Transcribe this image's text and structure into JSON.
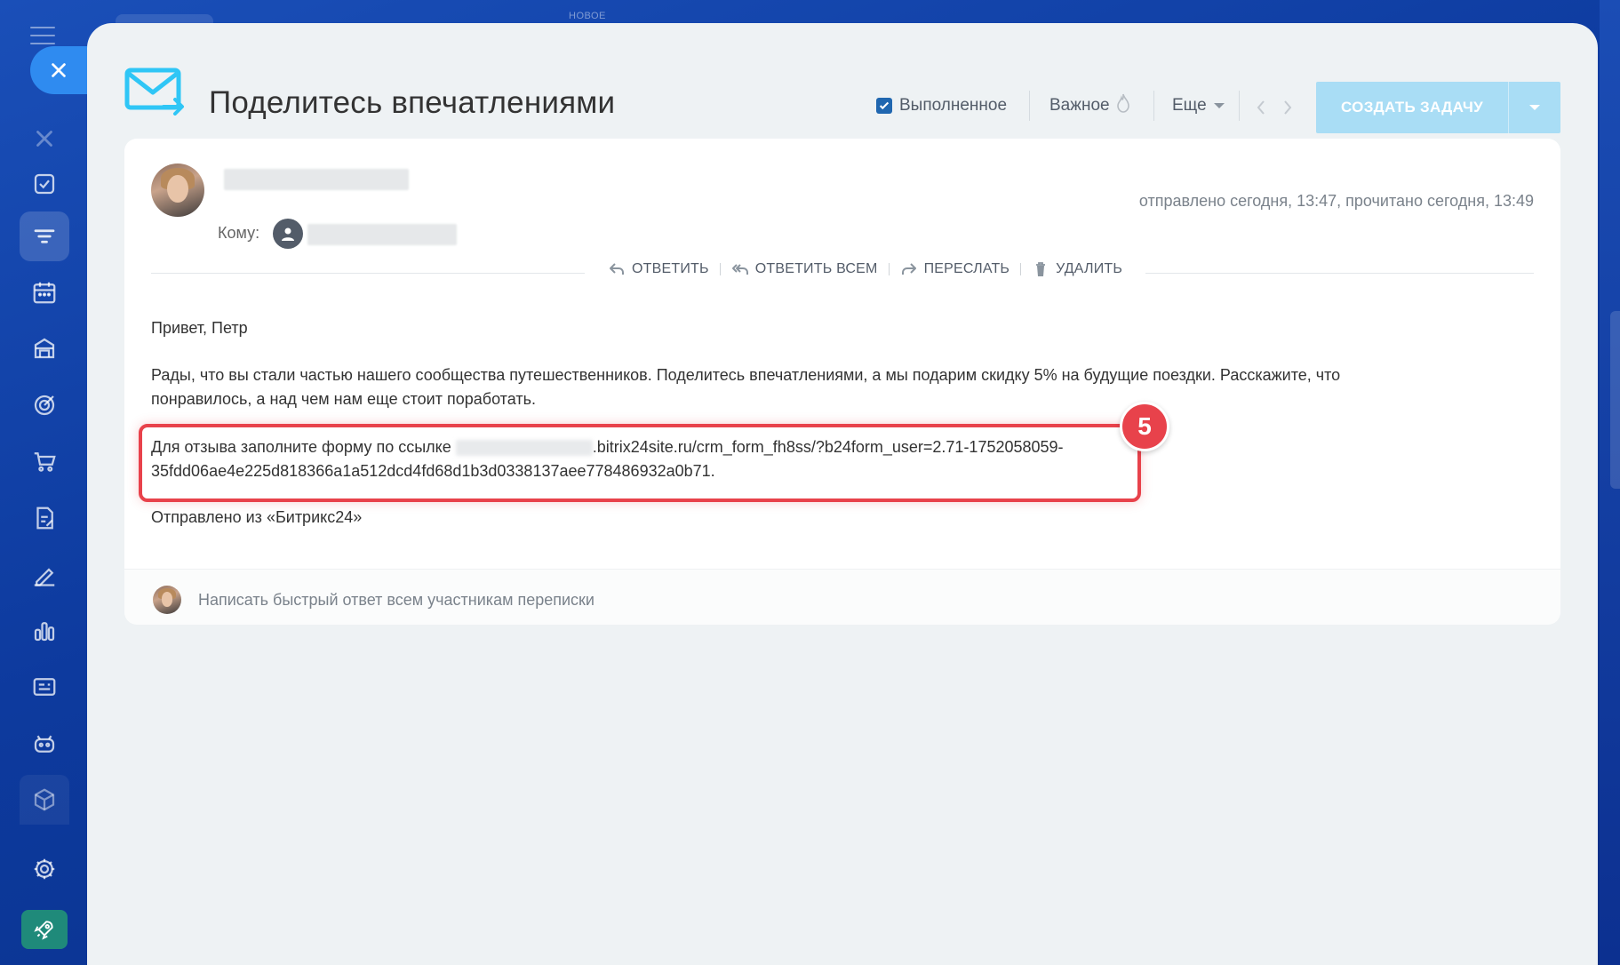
{
  "top_label": "НОВОЕ",
  "header": {
    "title": "Поделитесь впечатлениями",
    "done_label": "Выполненное",
    "done_checked": true,
    "important_label": "Важное",
    "more_label": "Еще",
    "create_task_label": "СОЗДАТЬ ЗАДАЧУ"
  },
  "message": {
    "to_label": "Кому:",
    "sent_info": "отправлено сегодня, 13:47, прочитано сегодня, 13:49",
    "actions": {
      "reply": "ОТВЕТИТЬ",
      "reply_all": "ОТВЕТИТЬ ВСЕМ",
      "forward": "ПЕРЕСЛАТЬ",
      "delete": "УДАЛИТЬ"
    },
    "greeting": "Привет, Петр",
    "paragraph1_line1": "Рады, что вы стали частью нашего сообщества путешественников. Поделитесь впечатлениями, а мы подарим скидку 5% на будущие поездки. Расскажите, что",
    "paragraph1_line2": "понравилось, а над чем нам еще стоит поработать.",
    "link_prefix": "Для отзыва заполните форму по ссылке ",
    "link_visible_part": ".bitrix24site.ru/crm_form_fh8ss/?b24form_user=2.71-1752058059-",
    "link_line2": "35fdd06ae4e225d818366a1a512dcd4fd68d1b3d0338137aee778486932a0b71.",
    "footer": "Отправлено из «Битрикс24»"
  },
  "callout_number": "5",
  "quick_reply_placeholder": "Написать быстрый ответ всем участникам переписки",
  "colors": {
    "accent": "#2f8bf0",
    "create_button": "#a9ddf5",
    "highlight": "#e8424b"
  }
}
